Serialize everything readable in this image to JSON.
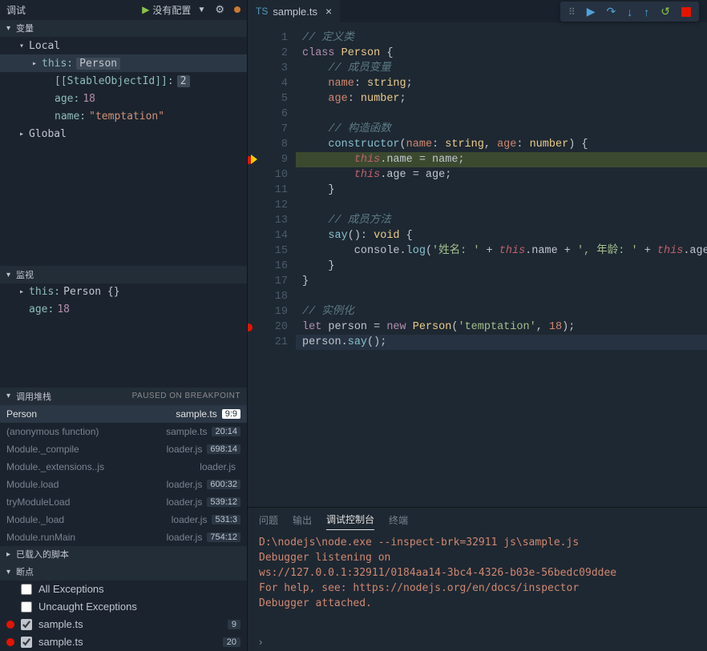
{
  "titlebar": {
    "title": "调试",
    "config": "没有配置"
  },
  "sections": {
    "variables": "变量",
    "watch": "监视",
    "callstack": "调用堆栈",
    "callstack_status": "PAUSED ON BREAKPOINT",
    "loaded": "已载入的脚本",
    "breakpoints": "断点"
  },
  "variables": {
    "scopes": [
      {
        "name": "Local",
        "expanded": true
      },
      {
        "name": "Global",
        "expanded": false
      }
    ],
    "local": {
      "this_key": "this:",
      "this_val": "Person",
      "stable_key": "[[StableObjectId]]:",
      "stable_val": "2",
      "age_key": "age:",
      "age_val": "18",
      "name_key": "name:",
      "name_val": "\"temptation\""
    }
  },
  "watch": [
    {
      "key": "this:",
      "val": "Person {}",
      "type": "plain",
      "expandable": true
    },
    {
      "key": "age:",
      "val": "18",
      "type": "num",
      "expandable": false
    }
  ],
  "callstack": [
    {
      "name": "Person",
      "file": "sample.ts",
      "loc": "9:9",
      "active": true
    },
    {
      "name": "(anonymous function)",
      "file": "sample.ts",
      "loc": "20:14"
    },
    {
      "name": "Module._compile",
      "file": "loader.js",
      "loc": "698:14"
    },
    {
      "name": "Module._extensions..js",
      "file": "loader.js",
      "loc": ""
    },
    {
      "name": "Module.load",
      "file": "loader.js",
      "loc": "600:32"
    },
    {
      "name": "tryModuleLoad",
      "file": "loader.js",
      "loc": "539:12"
    },
    {
      "name": "Module._load",
      "file": "loader.js",
      "loc": "531:3"
    },
    {
      "name": "Module.runMain",
      "file": "loader.js",
      "loc": "754:12"
    }
  ],
  "breakpoints": {
    "all_ex": "All Exceptions",
    "uncaught_ex": "Uncaught Exceptions",
    "items": [
      {
        "label": "sample.ts",
        "line": "9",
        "checked": true
      },
      {
        "label": "sample.ts",
        "line": "20",
        "checked": true
      }
    ]
  },
  "tab": {
    "name": "sample.ts"
  },
  "code": {
    "lines": [
      {
        "n": 1,
        "html": "<span class='c-cm'>// 定义类</span>"
      },
      {
        "n": 2,
        "html": "<span class='c-kw'>class</span> <span class='c-type'>Person</span> <span class='c-p'>{</span>"
      },
      {
        "n": 3,
        "html": "    <span class='c-cm'>// 成员变量</span>"
      },
      {
        "n": 4,
        "html": "    <span class='c-id'>name</span>: <span class='c-type'>string</span>;"
      },
      {
        "n": 5,
        "html": "    <span class='c-id'>age</span>: <span class='c-type'>number</span>;"
      },
      {
        "n": 6,
        "html": ""
      },
      {
        "n": 7,
        "html": "    <span class='c-cm'>// 构造函数</span>"
      },
      {
        "n": 8,
        "html": "    <span class='c-fn'>constructor</span>(<span class='c-id'>name</span>: <span class='c-type'>string</span>, <span class='c-id'>age</span>: <span class='c-type'>number</span>) <span class='c-p'>{</span>"
      },
      {
        "n": 9,
        "html": "        <span class='c-this'>this</span>.name = name;",
        "hl": true,
        "bp": true,
        "arrow": true
      },
      {
        "n": 10,
        "html": "        <span class='c-this'>this</span>.age = age;"
      },
      {
        "n": 11,
        "html": "    <span class='c-p'>}</span>"
      },
      {
        "n": 12,
        "html": ""
      },
      {
        "n": 13,
        "html": "    <span class='c-cm'>// 成员方法</span>"
      },
      {
        "n": 14,
        "html": "    <span class='c-fn'>say</span>(): <span class='c-type'>void</span> <span class='c-p'>{</span>"
      },
      {
        "n": 15,
        "html": "        console.<span class='c-fn'>log</span>(<span class='c-str'>'姓名: '</span> + <span class='c-this'>this</span>.name + <span class='c-str'>', 年龄: '</span> + <span class='c-this'>this</span>.age);"
      },
      {
        "n": 16,
        "html": "    <span class='c-p'>}</span>"
      },
      {
        "n": 17,
        "html": "<span class='c-p'>}</span>"
      },
      {
        "n": 18,
        "html": ""
      },
      {
        "n": 19,
        "html": "<span class='c-cm'>// 实例化</span>"
      },
      {
        "n": 20,
        "html": "<span class='c-kw'>let</span> person = <span class='c-kw'>new</span> <span class='c-type'>Person</span>(<span class='c-str'>'temptation'</span>, <span class='c-num'>18</span>);",
        "bp": true
      },
      {
        "n": 21,
        "html": "person.<span class='c-fn'>say</span>();",
        "cur": true
      }
    ]
  },
  "panel": {
    "tabs": [
      "问题",
      "输出",
      "调试控制台",
      "终端"
    ],
    "active_tab": 2,
    "lines": [
      "D:\\nodejs\\node.exe --inspect-brk=32911 js\\sample.js",
      "Debugger listening on",
      " ws://127.0.0.1:32911/0184aa14-3bc4-4326-b03e-56bedc09ddee",
      "For help, see: https://nodejs.org/en/docs/inspector",
      "Debugger attached."
    ]
  }
}
